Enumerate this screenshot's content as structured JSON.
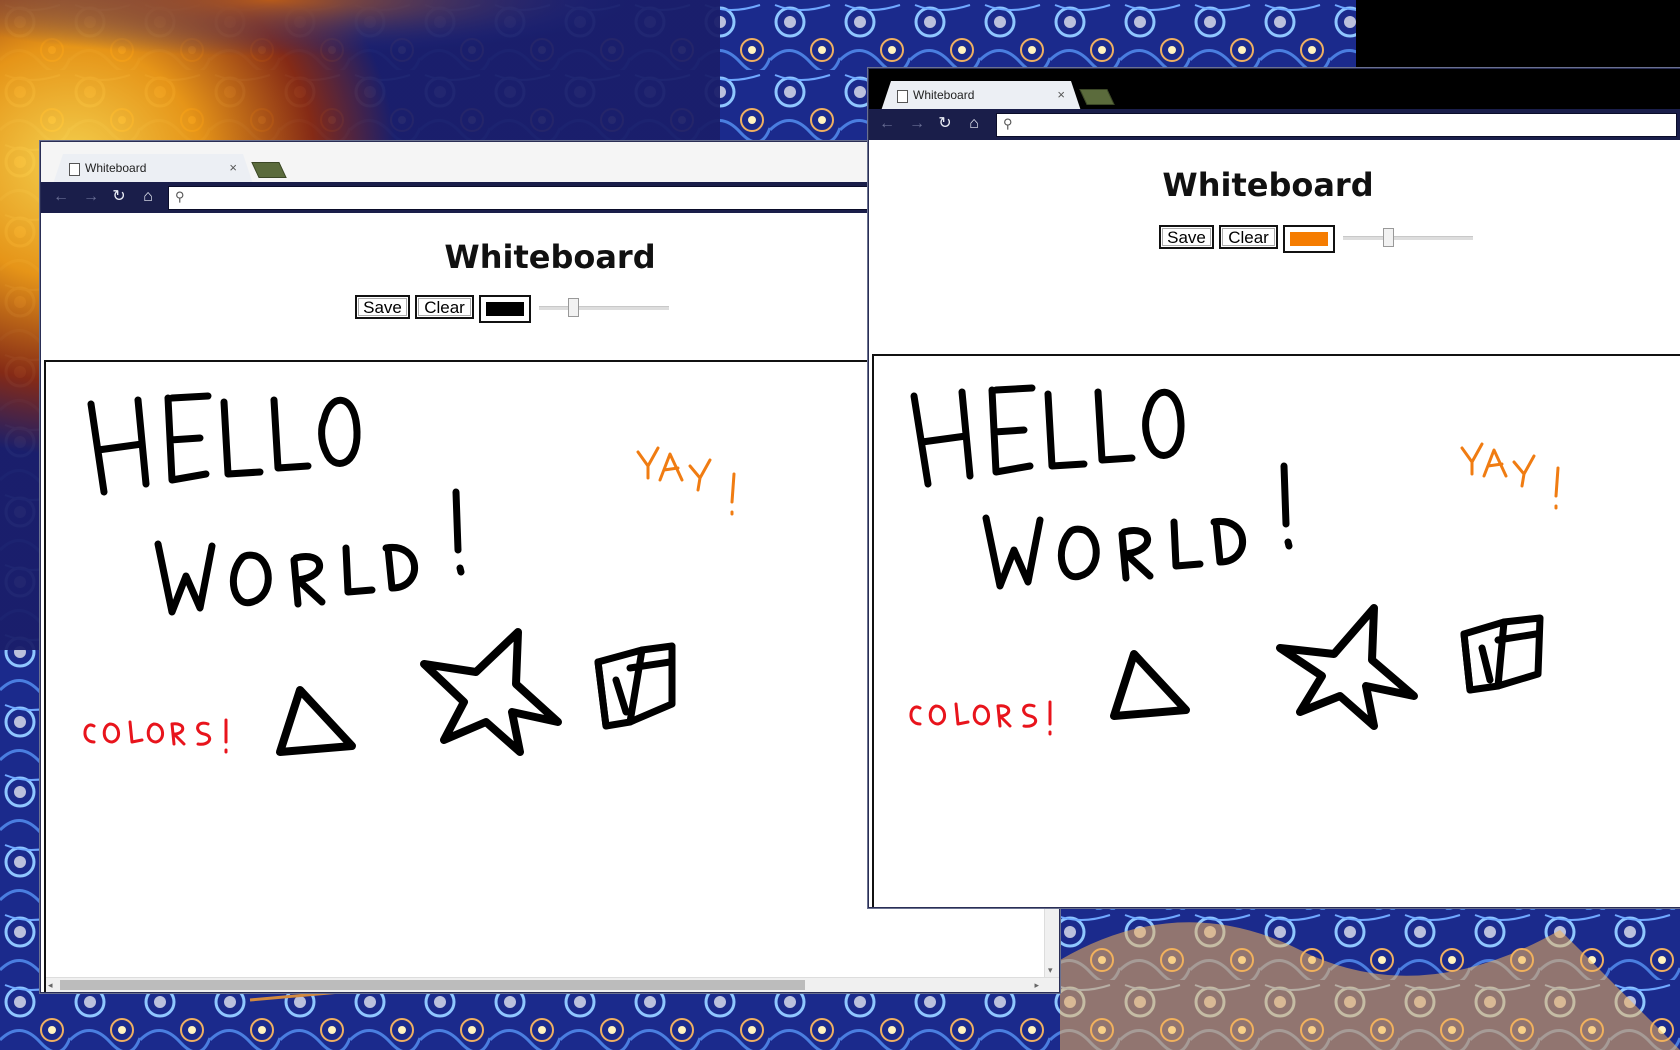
{
  "windows": [
    {
      "id": "left",
      "tab_title": "Whiteboard",
      "tab_close": "×",
      "omnibox_value": "",
      "page": {
        "title": "Whiteboard",
        "save_label": "Save",
        "clear_label": "Clear",
        "pen_color": "#000000",
        "pen_size_fraction": 0.24
      },
      "drawing": {
        "handwriting": [
          "HELLO",
          "WORLD!",
          "YAY!",
          "COLORS!"
        ],
        "colors": {
          "main": "#000000",
          "yay": "#f07c12",
          "colors_label": "#e8141c"
        }
      }
    },
    {
      "id": "right",
      "tab_title": "Whiteboard",
      "tab_close": "×",
      "omnibox_value": "",
      "page": {
        "title": "Whiteboard",
        "save_label": "Save",
        "clear_label": "Clear",
        "pen_color": "#f57c00",
        "pen_size_fraction": 0.34
      },
      "drawing": {
        "handwriting": [
          "HELLO",
          "WORLD!",
          "YAY!",
          "COLORS!"
        ],
        "colors": {
          "main": "#000000",
          "yay": "#f07c12",
          "colors_label": "#e8141c"
        }
      }
    }
  ],
  "icons": {
    "back": "←",
    "forward": "→",
    "reload": "↻",
    "home": "⌂",
    "search": "⚲",
    "scroll_left": "◂",
    "scroll_right": "▸",
    "scroll_down": "▾"
  },
  "theme": {
    "toolbar_bg": "#1a1e4a",
    "tab_bg": "#eceff4",
    "newtab_color": "#5b6b3c"
  }
}
